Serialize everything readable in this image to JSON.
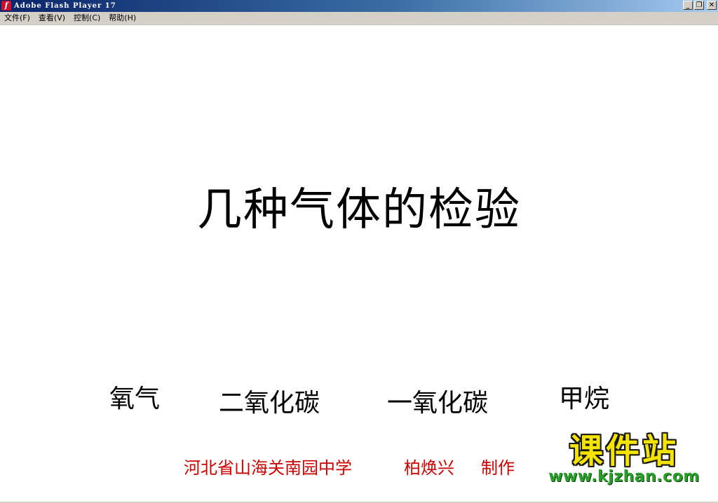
{
  "window": {
    "title": "Adobe Flash Player 17",
    "icon_glyph": "f",
    "controls": {
      "minimize": "_",
      "restore": "❐",
      "close": "✕"
    }
  },
  "menu": {
    "items": [
      "文件(F)",
      "查看(V)",
      "控制(C)",
      "帮助(H)"
    ]
  },
  "stage": {
    "title": "几种气体的检验",
    "gases": [
      "氧气",
      "二氧化碳",
      "一氧化碳",
      "甲烷"
    ],
    "credit": {
      "school": "河北省山海关南园中学",
      "author": "柏焕兴",
      "role": "制作"
    },
    "watermark": {
      "name": "课件站",
      "url": "www.kjzhan.com"
    }
  },
  "colors": {
    "credit": "#cc0000",
    "watermark_fill": "#f5e400",
    "watermark_url": "#2aa02a",
    "titlebar_start": "#0a246a"
  }
}
